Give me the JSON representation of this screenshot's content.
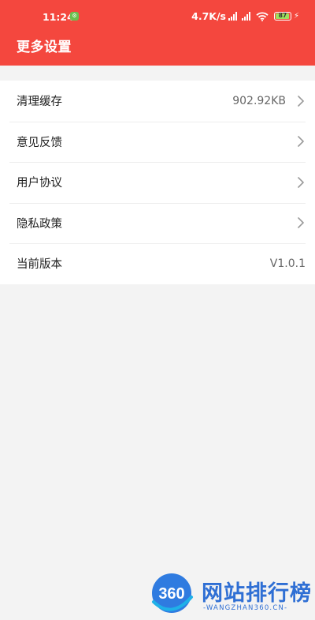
{
  "status_bar": {
    "time": "11:24",
    "app_icon_glyph": "⚙",
    "net_speed": "4.7K/s",
    "battery": "87",
    "charging_glyph": "⚡"
  },
  "header": {
    "title": "更多设置",
    "background_color": "#f4473e"
  },
  "settings": {
    "items": [
      {
        "label": "清理缓存",
        "value": "902.92KB",
        "arrow": true
      },
      {
        "label": "意见反馈",
        "value": "",
        "arrow": true
      },
      {
        "label": "用户协议",
        "value": "",
        "arrow": true
      },
      {
        "label": "隐私政策",
        "value": "",
        "arrow": true
      },
      {
        "label": "当前版本",
        "value": "V1.0.1",
        "arrow": false
      }
    ]
  },
  "watermark": {
    "logo_text": "360",
    "title": "网站排行榜",
    "subtitle": "-WANGZHAN360.CN-"
  }
}
